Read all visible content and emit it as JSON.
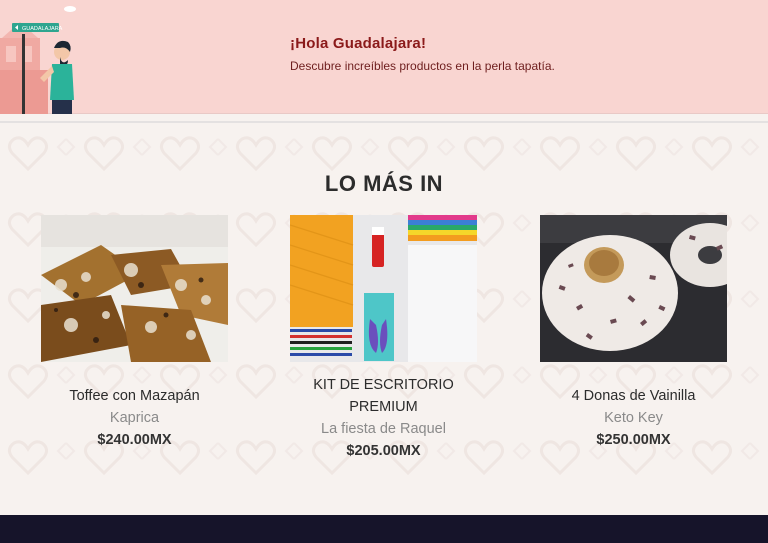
{
  "banner": {
    "sign_text": "GUADALAJARA",
    "title": "¡Hola Guadalajara!",
    "subtitle": "Descubre increíbles productos en la perla tapatía."
  },
  "section": {
    "title": "LO MÁS IN"
  },
  "products": [
    {
      "name": "Toffee con Mazapán",
      "brand": "Kaprica",
      "price": "$240.00MX"
    },
    {
      "name": "KIT DE ESCRITORIO PREMIUM",
      "brand": "La fiesta de Raquel",
      "price": "$205.00MX"
    },
    {
      "name": "4 Donas de Vainilla",
      "brand": "Keto Key",
      "price": "$250.00MX"
    }
  ],
  "colors": {
    "banner_bg": "#f9d5d1",
    "banner_title": "#8b1a1a",
    "page_bg": "#f7f2ef",
    "footer_bg": "#16142a"
  }
}
